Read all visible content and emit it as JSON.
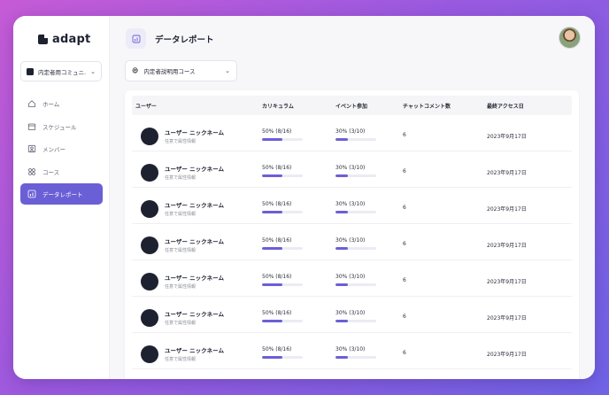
{
  "app": {
    "logo_text": "adapt",
    "community_label": "内定者用コミュニ...",
    "accent_color": "#6b5fd6"
  },
  "nav": [
    {
      "key": "home",
      "label": "ホーム",
      "icon": "home-icon",
      "active": false
    },
    {
      "key": "schedule",
      "label": "スケジュール",
      "icon": "calendar-icon",
      "active": false
    },
    {
      "key": "members",
      "label": "メンバー",
      "icon": "user-icon",
      "active": false
    },
    {
      "key": "courses",
      "label": "コース",
      "icon": "grid-icon",
      "active": false
    },
    {
      "key": "data-report",
      "label": "データレポート",
      "icon": "chart-icon",
      "active": true
    }
  ],
  "header": {
    "title": "データレポート",
    "icon": "chart-icon"
  },
  "course_select": {
    "emoji": "😄",
    "label": "内定者説明用コース"
  },
  "table": {
    "columns": [
      "ユーザー",
      "カリキュラム",
      "イベント参加",
      "チャットコメント数",
      "最終アクセス日"
    ],
    "rows": [
      {
        "name": "ユーザー ニックネーム",
        "sub": "任意で属性情報",
        "curriculum": "50% (8/16)",
        "curriculum_progress": 0.5,
        "event": "30% (3/10)",
        "event_progress": 0.3,
        "comments": "6",
        "last_access": "2023年9月17日"
      },
      {
        "name": "ユーザー ニックネーム",
        "sub": "任意で属性情報",
        "curriculum": "50% (8/16)",
        "curriculum_progress": 0.5,
        "event": "30% (3/10)",
        "event_progress": 0.3,
        "comments": "6",
        "last_access": "2023年9月17日"
      },
      {
        "name": "ユーザー ニックネーム",
        "sub": "任意で属性情報",
        "curriculum": "50% (8/16)",
        "curriculum_progress": 0.5,
        "event": "30% (3/10)",
        "event_progress": 0.3,
        "comments": "6",
        "last_access": "2023年9月17日"
      },
      {
        "name": "ユーザー ニックネーム",
        "sub": "任意で属性情報",
        "curriculum": "50% (8/16)",
        "curriculum_progress": 0.5,
        "event": "30% (3/10)",
        "event_progress": 0.3,
        "comments": "6",
        "last_access": "2023年9月17日"
      },
      {
        "name": "ユーザー ニックネーム",
        "sub": "任意で属性情報",
        "curriculum": "50% (8/16)",
        "curriculum_progress": 0.5,
        "event": "30% (3/10)",
        "event_progress": 0.3,
        "comments": "6",
        "last_access": "2023年9月17日"
      },
      {
        "name": "ユーザー ニックネーム",
        "sub": "任意で属性情報",
        "curriculum": "50% (8/16)",
        "curriculum_progress": 0.5,
        "event": "30% (3/10)",
        "event_progress": 0.3,
        "comments": "6",
        "last_access": "2023年9月17日"
      },
      {
        "name": "ユーザー ニックネーム",
        "sub": "任意で属性情報",
        "curriculum": "50% (8/16)",
        "curriculum_progress": 0.5,
        "event": "30% (3/10)",
        "event_progress": 0.3,
        "comments": "6",
        "last_access": "2023年9月17日"
      }
    ]
  }
}
